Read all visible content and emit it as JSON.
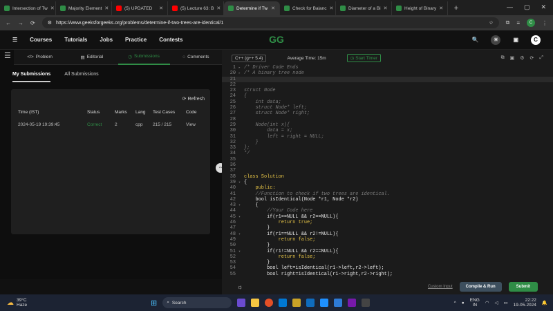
{
  "browser": {
    "tabs": [
      {
        "label": "Intersection of Tw",
        "color": "#2f8d46"
      },
      {
        "label": "Majority Element",
        "color": "#2f8d46"
      },
      {
        "label": "(5) UPDATED",
        "color": "#ff0000"
      },
      {
        "label": "(5) Lecture 63: B",
        "color": "#ff0000"
      },
      {
        "label": "Determine if Tw",
        "color": "#2f8d46",
        "active": true
      },
      {
        "label": "Check for Balanc",
        "color": "#2f8d46"
      },
      {
        "label": "Diameter of a Bi",
        "color": "#2f8d46"
      },
      {
        "label": "Height of Binary",
        "color": "#2f8d46"
      }
    ],
    "url": "https://www.geeksforgeeks.org/problems/determine-if-two-trees-are-identical/1",
    "profile_initial": "C"
  },
  "nav": {
    "items": [
      "Courses",
      "Tutorials",
      "Jobs",
      "Practice",
      "Contests"
    ],
    "logo": "GG"
  },
  "left": {
    "tabs": [
      "Problem",
      "Editorial",
      "Submissions",
      "Comments"
    ],
    "subtabs": [
      "My Submissions",
      "All Submissions"
    ],
    "refresh": "Refresh",
    "headers": [
      "Time (IST)",
      "Status",
      "Marks",
      "Lang",
      "Test Cases",
      "Code"
    ],
    "rows": [
      [
        "2024-05-19 19:39:45",
        "Correct",
        "2",
        "cpp",
        "215 / 215",
        "View"
      ]
    ]
  },
  "editor": {
    "language": "C++ (g++ 5.4)",
    "avg_time": "Average Time: 15m",
    "timer": "Start Timer",
    "custom_input": "Custom Input",
    "compile": "Compile & Run",
    "submit": "Submit",
    "lines": [
      {
        "n": "1",
        "t": "/* Driver Code Ends",
        "cls": "cm",
        "fold": "▸"
      },
      {
        "n": "20",
        "t": "/* A binary tree node",
        "cls": "cm",
        "fold": "▸"
      },
      {
        "n": "21",
        "t": "",
        "cls": "txt",
        "cur": true
      },
      {
        "n": "22",
        "t": "",
        "cls": "txt"
      },
      {
        "n": "23",
        "t": "struct Node",
        "cls": "cm"
      },
      {
        "n": "24",
        "t": "{",
        "cls": "cm"
      },
      {
        "n": "25",
        "t": "    int data;",
        "cls": "cm"
      },
      {
        "n": "26",
        "t": "    struct Node* left;",
        "cls": "cm"
      },
      {
        "n": "27",
        "t": "    struct Node* right;",
        "cls": "cm"
      },
      {
        "n": "28",
        "t": "",
        "cls": "cm"
      },
      {
        "n": "29",
        "t": "    Node(int x){",
        "cls": "cm"
      },
      {
        "n": "30",
        "t": "        data = x;",
        "cls": "cm"
      },
      {
        "n": "31",
        "t": "        left = right = NULL;",
        "cls": "cm"
      },
      {
        "n": "32",
        "t": "    }",
        "cls": "cm"
      },
      {
        "n": "33",
        "t": "};",
        "cls": "cm"
      },
      {
        "n": "34",
        "t": "*/",
        "cls": "cm"
      },
      {
        "n": "35",
        "t": "",
        "cls": "txt"
      },
      {
        "n": "36",
        "t": "",
        "cls": "txt"
      },
      {
        "n": "37",
        "t": "",
        "cls": "txt"
      },
      {
        "n": "38",
        "t": "class Solution",
        "cls": "kw"
      },
      {
        "n": "39",
        "t": "{",
        "cls": "txt",
        "fold": "▾"
      },
      {
        "n": "40",
        "t": "    public:",
        "cls": "kw"
      },
      {
        "n": "41",
        "t": "    //Function to check if two trees are identical.",
        "cls": "cm"
      },
      {
        "n": "42",
        "t": "    bool isIdentical(Node *r1, Node *r2)",
        "cls": "txt"
      },
      {
        "n": "43",
        "t": "    {",
        "cls": "txt",
        "fold": "▾"
      },
      {
        "n": "44",
        "t": "        //Your Code here",
        "cls": "cm"
      },
      {
        "n": "45",
        "t": "        if(r1==NULL && r2==NULL){",
        "cls": "txt",
        "fold": "▾"
      },
      {
        "n": "46",
        "t": "            return true;",
        "cls": "kw"
      },
      {
        "n": "47",
        "t": "        }",
        "cls": "txt"
      },
      {
        "n": "48",
        "t": "        if(r1==NULL && r2!=NULL){",
        "cls": "txt",
        "fold": "▾"
      },
      {
        "n": "49",
        "t": "            return false;",
        "cls": "kw"
      },
      {
        "n": "50",
        "t": "        }",
        "cls": "txt"
      },
      {
        "n": "51",
        "t": "        if(r1!=NULL && r2==NULL){",
        "cls": "txt",
        "fold": "▾"
      },
      {
        "n": "52",
        "t": "            return false;",
        "cls": "kw"
      },
      {
        "n": "53",
        "t": "        }",
        "cls": "txt"
      },
      {
        "n": "54",
        "t": "        bool left=isIdentical(r1->left,r2->left);",
        "cls": "txt"
      },
      {
        "n": "55",
        "t": "        bool right=isIdentical(r1->right,r2->right);",
        "cls": "txt"
      }
    ]
  },
  "taskbar": {
    "weather_temp": "39°C",
    "weather_desc": "Haze",
    "search": "Search",
    "lang1": "ENG",
    "lang2": "IN",
    "time": "22:22",
    "date": "19-05-2024"
  }
}
